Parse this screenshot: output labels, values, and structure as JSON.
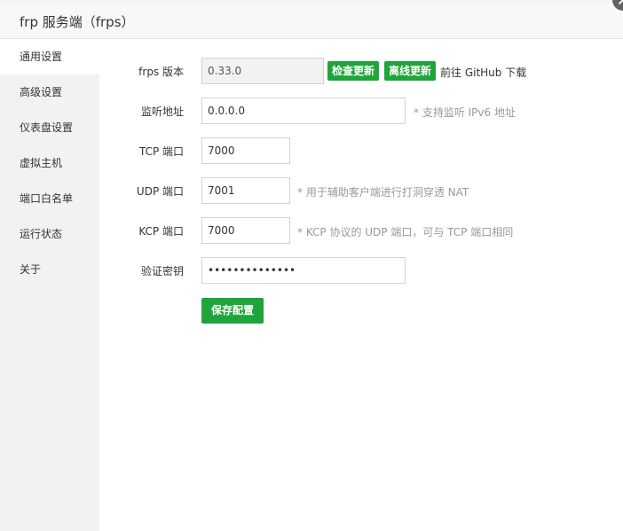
{
  "window": {
    "title": "frp 服务端（frps）"
  },
  "sidebar": {
    "items": [
      {
        "label": "通用设置"
      },
      {
        "label": "高级设置"
      },
      {
        "label": "仪表盘设置"
      },
      {
        "label": "虚拟主机"
      },
      {
        "label": "端口白名单"
      },
      {
        "label": "运行状态"
      },
      {
        "label": "关于"
      }
    ],
    "active_index": 0
  },
  "form": {
    "version": {
      "label": "frps 版本",
      "value": "0.33.0",
      "check_update_label": "检查更新",
      "offline_update_label": "离线更新",
      "github_link_label": "前往 GitHub 下载"
    },
    "listen_addr": {
      "label": "监听地址",
      "value": "0.0.0.0",
      "hint": "* 支持监听 IPv6 地址"
    },
    "tcp_port": {
      "label": "TCP 端口",
      "value": "7000"
    },
    "udp_port": {
      "label": "UDP 端口",
      "value": "7001",
      "hint": "* 用于辅助客户端进行打洞穿透 NAT"
    },
    "kcp_port": {
      "label": "KCP 端口",
      "value": "7000",
      "hint": "* KCP 协议的 UDP 端口，可与 TCP 端口相同"
    },
    "token": {
      "label": "验证密钥",
      "value": "••••••••••••••"
    },
    "save_label": "保存配置"
  },
  "colors": {
    "accent": "#1fa53b",
    "sidebar_bg": "#f2f2f2",
    "hint": "#999999"
  }
}
